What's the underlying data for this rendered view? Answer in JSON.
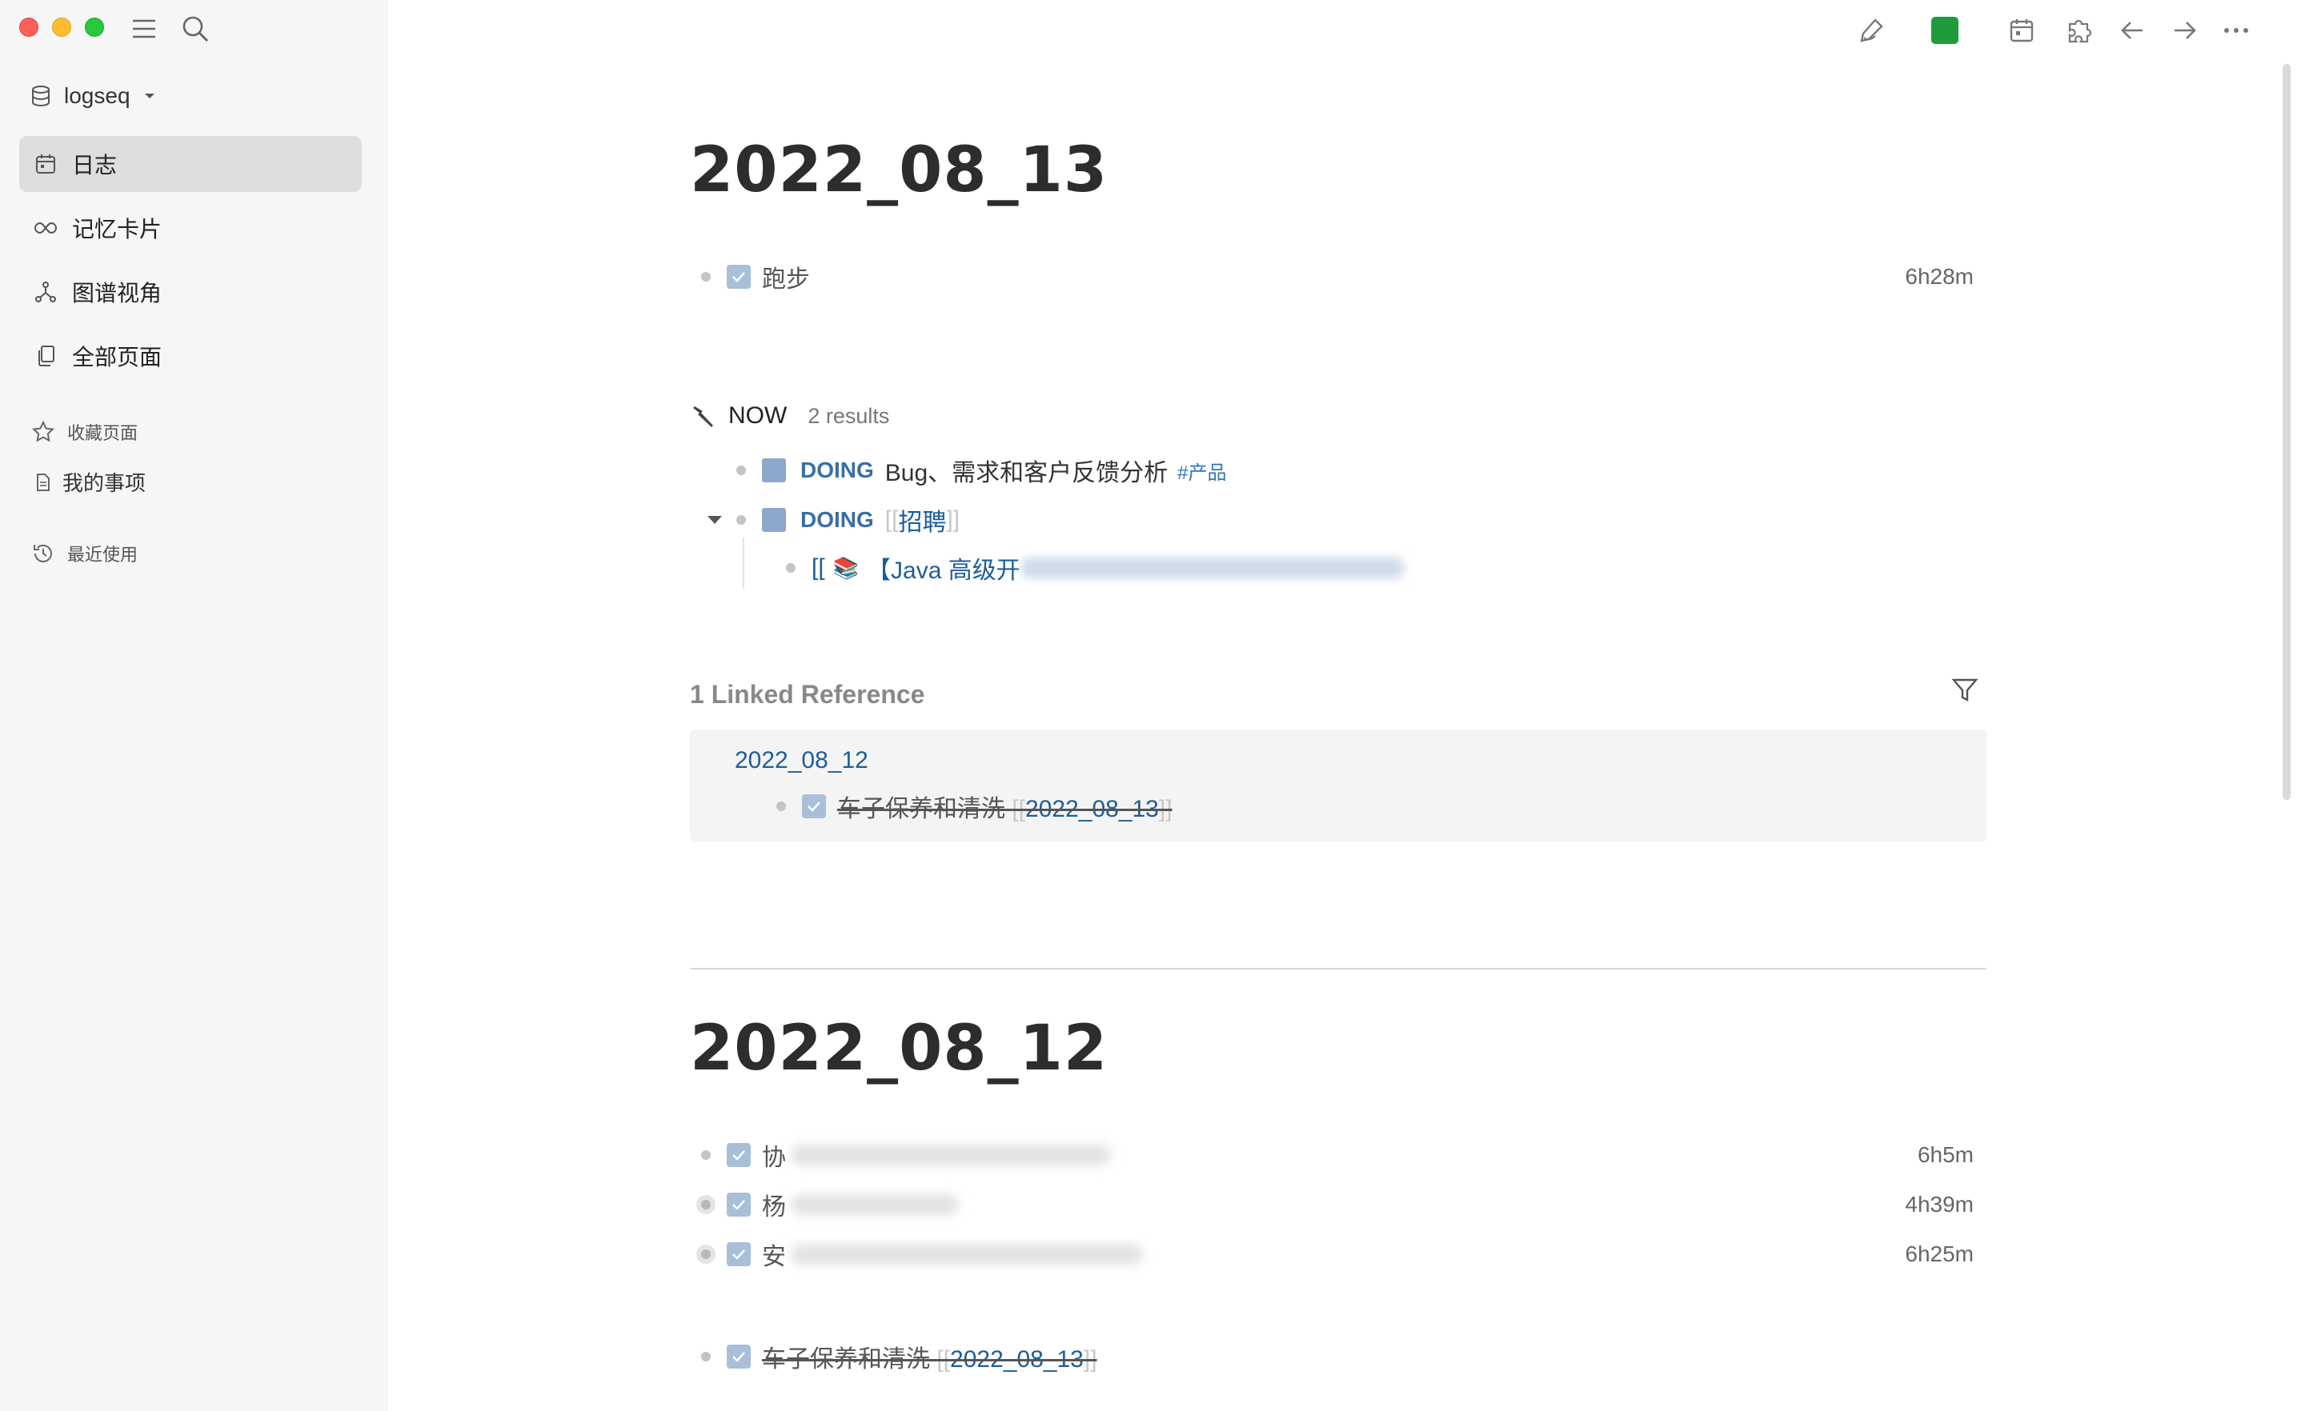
{
  "sidebar": {
    "repo_name": "logseq",
    "nav": [
      {
        "label": "日志",
        "icon": "calendar-icon",
        "active": true
      },
      {
        "label": "记忆卡片",
        "icon": "infinity-icon"
      },
      {
        "label": "图谱视角",
        "icon": "graph-icon"
      },
      {
        "label": "全部页面",
        "icon": "pages-icon"
      }
    ],
    "favorites_label": "收藏页面",
    "favorites": [
      {
        "label": "我的事项"
      }
    ],
    "recent_label": "最近使用"
  },
  "toolbar": {
    "icons": [
      "edit-icon",
      "sync-status-icon",
      "calendar-icon",
      "plugins-icon",
      "back-icon",
      "forward-icon",
      "more-icon"
    ],
    "sync_color": "#1f9b3c"
  },
  "journal1": {
    "title": "2022_08_13",
    "task": {
      "text": "跑步",
      "duration": "6h28m"
    },
    "query": {
      "title": "NOW",
      "count": "2 results",
      "items": [
        {
          "marker": "DOING",
          "text": "Bug、需求和客户反馈分析",
          "tag": "#产品"
        },
        {
          "marker": "DOING",
          "open": "[[",
          "link": "招聘",
          "close": "]]"
        }
      ],
      "child": {
        "open": "[[",
        "emoji": "📚",
        "text": "【Java 高级开"
      }
    },
    "linked": {
      "title": "1 Linked Reference",
      "page": "2022_08_12",
      "item": {
        "text": "车子保养和清洗",
        "open": "[[",
        "link": "2022_08_13",
        "close": "]]"
      }
    }
  },
  "journal2": {
    "title": "2022_08_12",
    "tasks": [
      {
        "text": "协",
        "duration": "6h5m"
      },
      {
        "text": "杨",
        "duration": "4h39m"
      },
      {
        "text": "安",
        "duration": "6h25m"
      }
    ],
    "last": {
      "text": "车子保养和清洗",
      "open": "[[",
      "link": "2022_08_13",
      "close": "]]"
    }
  }
}
